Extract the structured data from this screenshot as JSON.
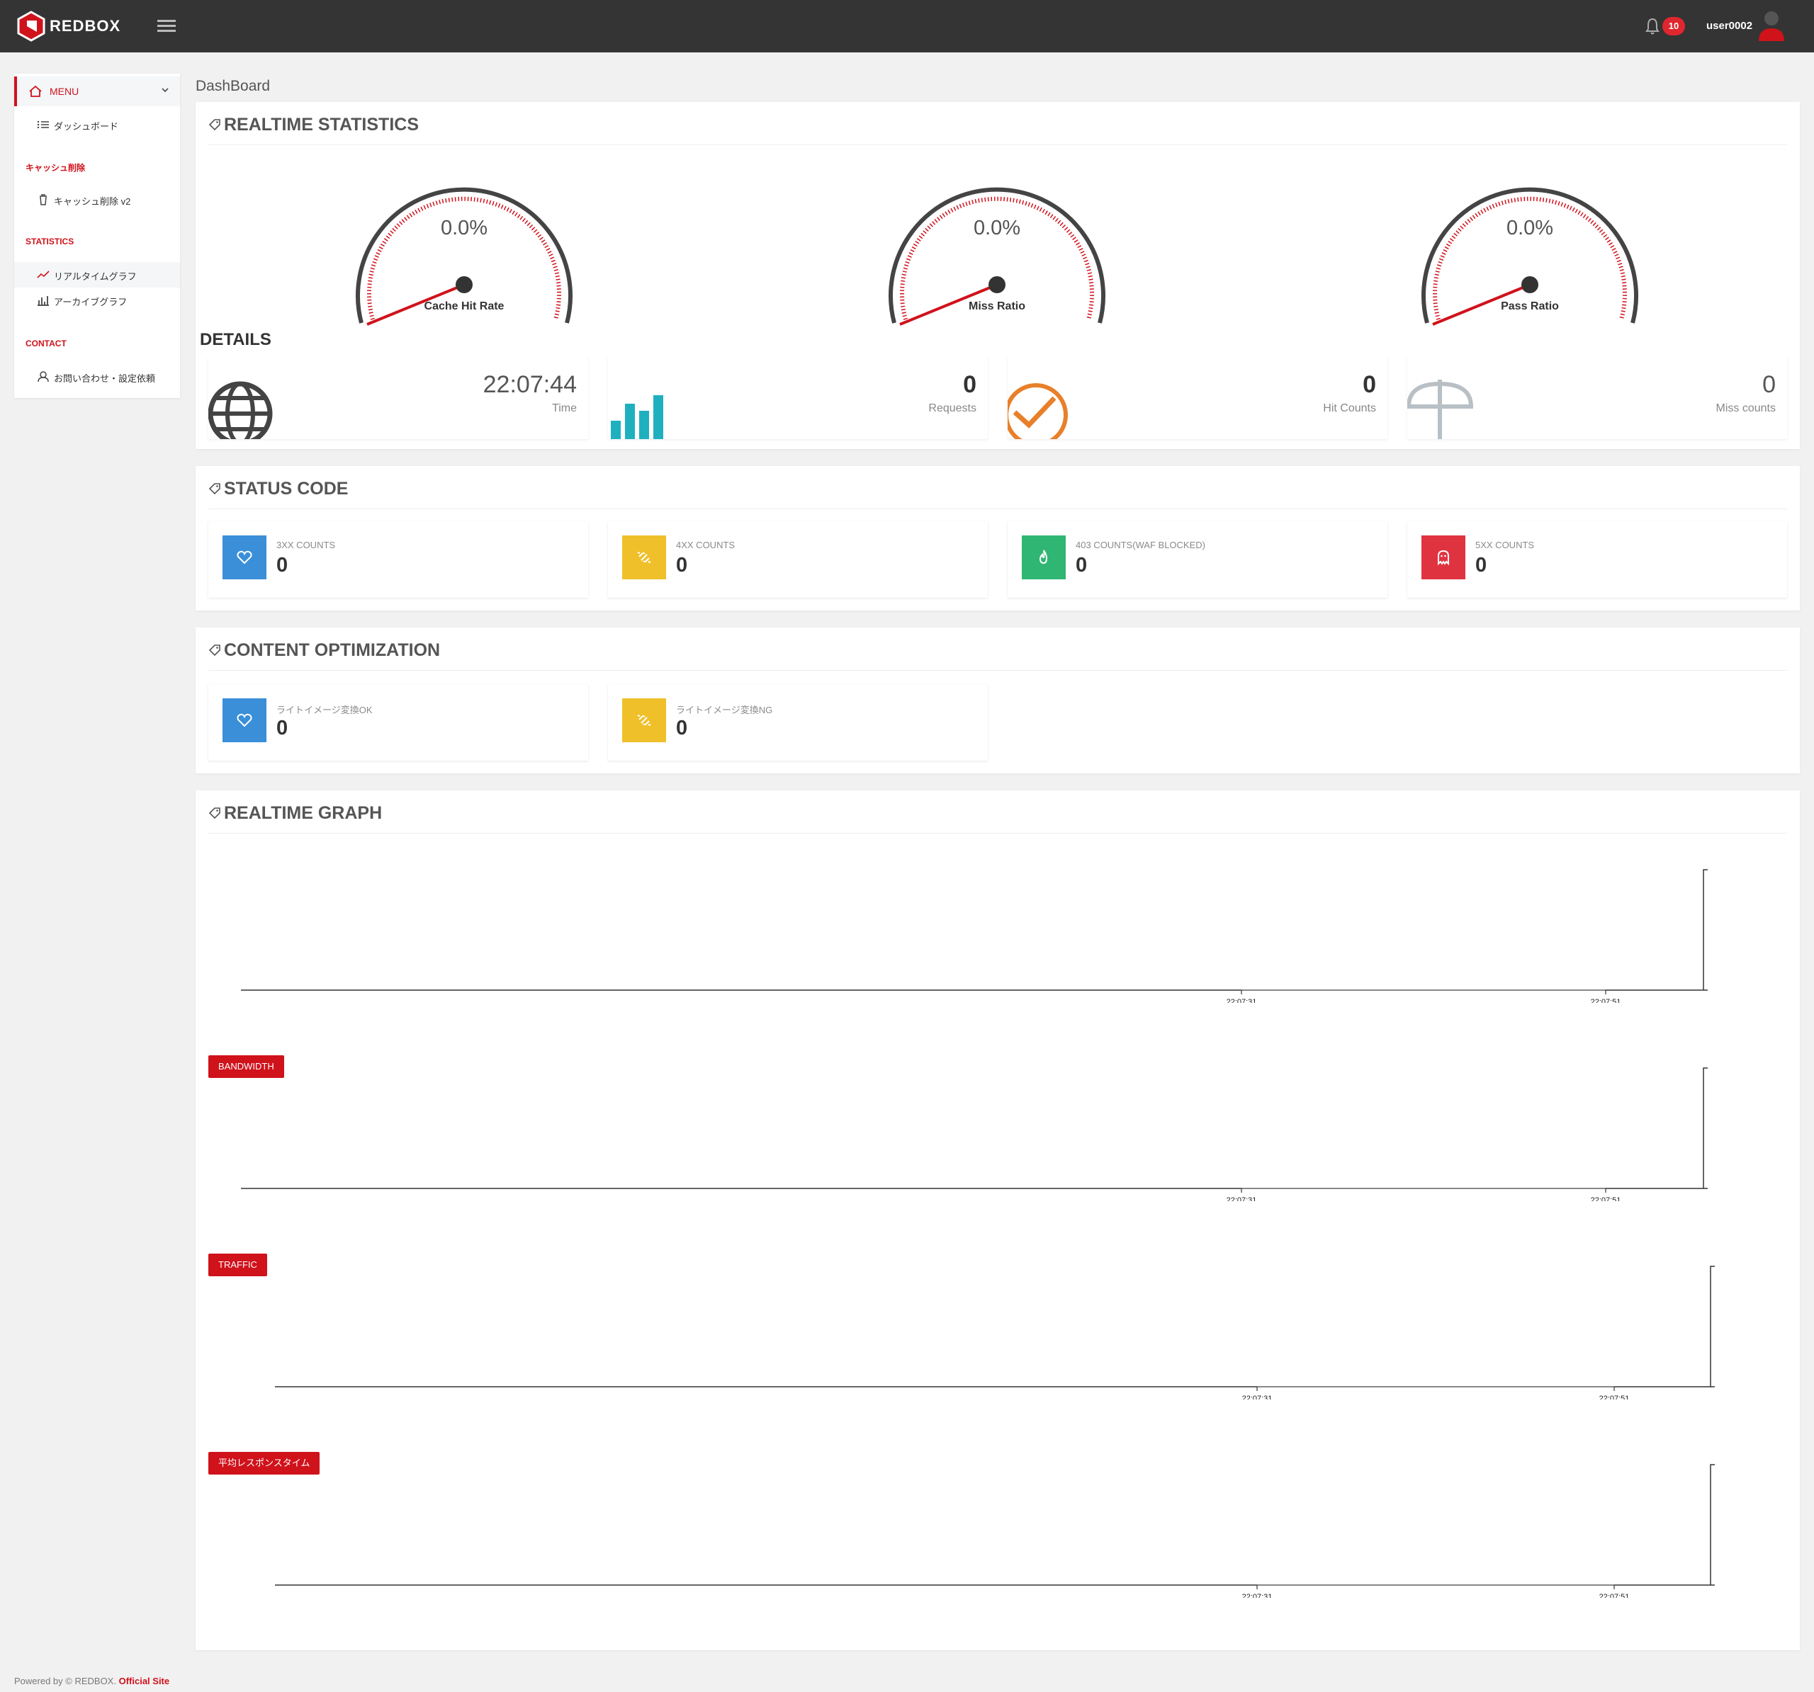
{
  "app": {
    "brand": "REDBOX",
    "notifications_count": "10",
    "username": "user0002",
    "accent": "#d0121b"
  },
  "sidebar": {
    "menu_label": "MENU",
    "items": [
      {
        "label": "ダッシュボード",
        "icon": "list-icon"
      },
      {
        "section": "キャッシュ削除"
      },
      {
        "label": "キャッシュ削除 v2",
        "icon": "trash-icon"
      },
      {
        "section": "STATISTICS"
      },
      {
        "label": "リアルタイムグラフ",
        "icon": "line-chart-icon"
      },
      {
        "label": "アーカイブグラフ",
        "icon": "bar-chart-icon"
      },
      {
        "section": "CONTACT"
      },
      {
        "label": "お問い合わせ・設定依頼",
        "icon": "user-icon"
      }
    ]
  },
  "breadcrumb": "DashBoard",
  "realtime": {
    "title": "REALTIME STATISTICS",
    "gauges": [
      {
        "value": "0.0%",
        "label": "Cache Hit Rate"
      },
      {
        "value": "0.0%",
        "label": "Miss Ratio"
      },
      {
        "value": "0.0%",
        "label": "Pass Ratio"
      }
    ],
    "details_title": "DETAILS",
    "details": [
      {
        "value": "22:07:44",
        "caption": "Time",
        "icon": "globe-icon"
      },
      {
        "value": "0",
        "caption": "Requests",
        "icon": "bar-chart-icon"
      },
      {
        "value": "0",
        "caption": "Hit Counts",
        "icon": "check-icon"
      },
      {
        "value": "0",
        "caption": "Miss counts",
        "icon": "umbrella-icon"
      }
    ]
  },
  "status_code": {
    "title": "STATUS CODE",
    "cards": [
      {
        "label": "3XX COUNTS",
        "value": "0",
        "color": "#3a8fd8",
        "icon": "heart-icon"
      },
      {
        "label": "4XX COUNTS",
        "value": "0",
        "color": "#f0c02a",
        "icon": "broken-link-icon"
      },
      {
        "label": "403 COUNTS(WAF BLOCKED)",
        "value": "0",
        "color": "#2fb673",
        "icon": "fire-icon"
      },
      {
        "label": "5XX COUNTS",
        "value": "0",
        "color": "#e03340",
        "icon": "ghost-icon"
      }
    ]
  },
  "content_optimization": {
    "title": "CONTENT OPTIMIZATION",
    "cards": [
      {
        "label": "ライトイメージ変換OK",
        "value": "0",
        "color": "#3a8fd8",
        "icon": "heart-icon"
      },
      {
        "label": "ライトイメージ変換NG",
        "value": "0",
        "color": "#f0c02a",
        "icon": "broken-link-icon"
      }
    ]
  },
  "realtime_graph": {
    "title": "REALTIME GRAPH",
    "chips": [
      "BANDWIDTH",
      "TRAFFIC",
      "平均レスポンスタイム"
    ]
  },
  "chart_data": [
    {
      "type": "line",
      "title": "",
      "x": [
        "22:07:31",
        "22:07:51"
      ],
      "series": [
        {
          "values": [
            0,
            0
          ]
        }
      ]
    },
    {
      "type": "line",
      "title": "BANDWIDTH",
      "x": [
        "22:07:31",
        "22:07:51"
      ],
      "series": [
        {
          "values": [
            0,
            0
          ]
        }
      ]
    },
    {
      "type": "line",
      "title": "TRAFFIC",
      "x": [
        "22:07:31",
        "22:07:51"
      ],
      "series": [
        {
          "values": [
            0,
            0
          ]
        }
      ]
    },
    {
      "type": "line",
      "title": "平均レスポンスタイム",
      "x": [
        "22:07:31",
        "22:07:51"
      ],
      "series": [
        {
          "values": [
            0,
            0
          ]
        }
      ]
    }
  ],
  "footer": {
    "text": "Powered by © REDBOX.",
    "link": "Official Site"
  }
}
